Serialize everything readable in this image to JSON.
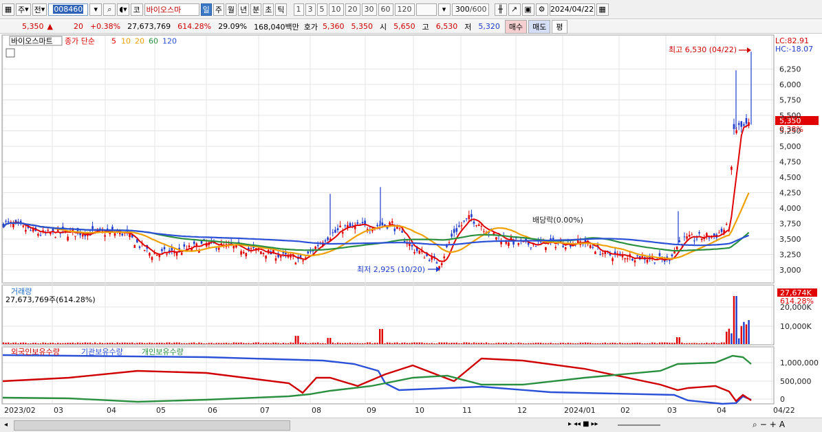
{
  "toolbar": {
    "market": "주",
    "compare": "전",
    "code": "008460",
    "name": "바이오스마",
    "period_tabs": [
      "일",
      "주",
      "월",
      "년",
      "분",
      "초",
      "틱"
    ],
    "active_period": "일",
    "intervals": [
      "1",
      "3",
      "5",
      "10",
      "20",
      "30",
      "60",
      "120"
    ],
    "count": "300",
    "count_total": "/600",
    "date": "2024/04/22"
  },
  "quote": {
    "price": "5,350",
    "arrow": "▲",
    "change": "20",
    "change_pct": "+0.38%",
    "volume": "27,673,769",
    "volume_pct": "614.28%",
    "turnover": "29.09%",
    "amount": "168,040백만",
    "hoga_label": "호가",
    "ask": "5,360",
    "bid": "5,350",
    "open_label": "시",
    "open": "5,650",
    "high_label": "고",
    "high": "6,530",
    "low_label": "저",
    "low": "5,320",
    "buy": "매수",
    "sell": "매도",
    "eval": "평"
  },
  "price_panel": {
    "stock_name": "바이오스마트",
    "ma_label": "종가 단순",
    "ma_periods": [
      "5",
      "10",
      "20",
      "60",
      "120"
    ],
    "ma_colors": [
      "#e00000",
      "#f0a000",
      "#f0a000",
      "#2a9040",
      "#2a50d8"
    ],
    "lc": "LC:82.91",
    "hc": "HC:-18.07",
    "high_note": "최고 6,530 (04/22)",
    "low_note": "최저 2,925 (10/20)",
    "div_note": "배당락(0.00%)",
    "current_price": "5,350",
    "current_pct": "0.38%",
    "yticks": [
      "6,250",
      "6,000",
      "5,750",
      "5,500",
      "5,250",
      "5,000",
      "4,750",
      "4,500",
      "4,250",
      "4,000",
      "3,750",
      "3,500",
      "3,250",
      "3,000"
    ]
  },
  "volume_panel": {
    "title": "거래량",
    "subtitle": "27,673,769주(614.28%)",
    "current": "27,674K",
    "current_pct": "614.28%",
    "yticks": [
      "20,000K",
      "10,000K"
    ]
  },
  "holding_panel": {
    "legend": [
      "외국인보유수량",
      "기관보유수량",
      "개인보유수량"
    ],
    "colors": [
      "#d00000",
      "#2a50d8",
      "#2a9040"
    ],
    "yticks": [
      "1,000,000",
      "500,000",
      "0"
    ]
  },
  "xaxis": [
    "2023/02",
    "03",
    "04",
    "05",
    "06",
    "07",
    "08",
    "09",
    "10",
    "11",
    "12",
    "2024/01",
    "02",
    "03",
    "04",
    "04/22"
  ]
}
